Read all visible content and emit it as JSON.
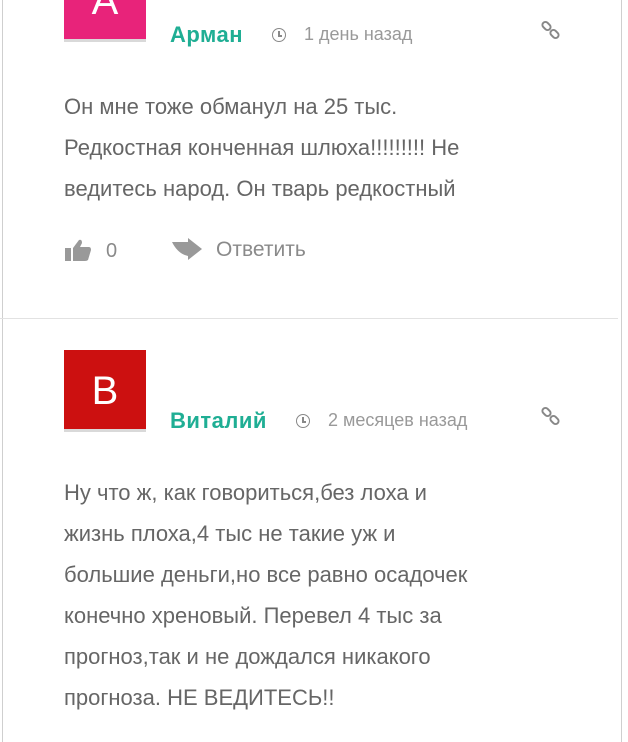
{
  "colors": {
    "accent": "#1fae94",
    "avatar_a": "#e8237a",
    "avatar_b": "#cc1010"
  },
  "comments": [
    {
      "avatar_letter": "А",
      "author": "Арман",
      "date": "1 день назад",
      "text_lines": [
        "Он мне тоже обманул на 25 тыс.",
        "Редкостная конченная шлюха!!!!!!!!! Не",
        "ведитесь народ. Он тварь редкостный"
      ],
      "likes": "0",
      "reply_label": "Ответить"
    },
    {
      "avatar_letter": "В",
      "author": "Виталий",
      "date": "2 месяцев назад",
      "text_lines": [
        "Ну что ж, как говориться,без лоха и",
        "жизнь плоха,4 тыс не такие уж и",
        "большие деньги,но все равно осадочек",
        "конечно хреновый. Перевел 4 тыс за",
        "прогноз,так и не дождался никакого",
        "прогноза. НЕ ВЕДИТЕСЬ!!"
      ]
    }
  ]
}
